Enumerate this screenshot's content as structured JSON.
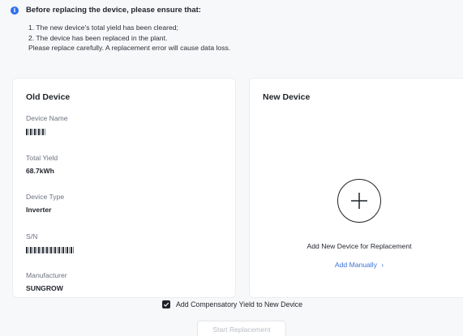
{
  "notice": {
    "icon": "info-icon",
    "heading": "Before replacing the device, please ensure that:",
    "line1": "1. The new device's total yield has been cleared;",
    "line2": "2. The device has been replaced in the plant.",
    "line3": "Please replace carefully. A replacement error will cause data loss."
  },
  "old_device": {
    "title": "Old Device",
    "name_label": "Device Name",
    "yield_label": "Total Yield",
    "yield_value": "68.7kWh",
    "type_label": "Device Type",
    "type_value": "Inverter",
    "sn_label": "S/N",
    "manufacturer_label": "Manufacturer",
    "manufacturer_value": "SUNGROW"
  },
  "new_device": {
    "title": "New Device",
    "add_caption": "Add New Device for Replacement",
    "add_manually": "Add Manually",
    "add_icon": "plus-icon",
    "chevron_icon": "chevron-right-icon"
  },
  "footer": {
    "compensate_label": "Add Compensatory Yield to New Device",
    "compensate_checked": true,
    "start_button": "Start Replacement"
  },
  "colors": {
    "accent": "#2f6ff0",
    "link": "#3a72d8",
    "disabled_text": "#b9bdc4"
  }
}
